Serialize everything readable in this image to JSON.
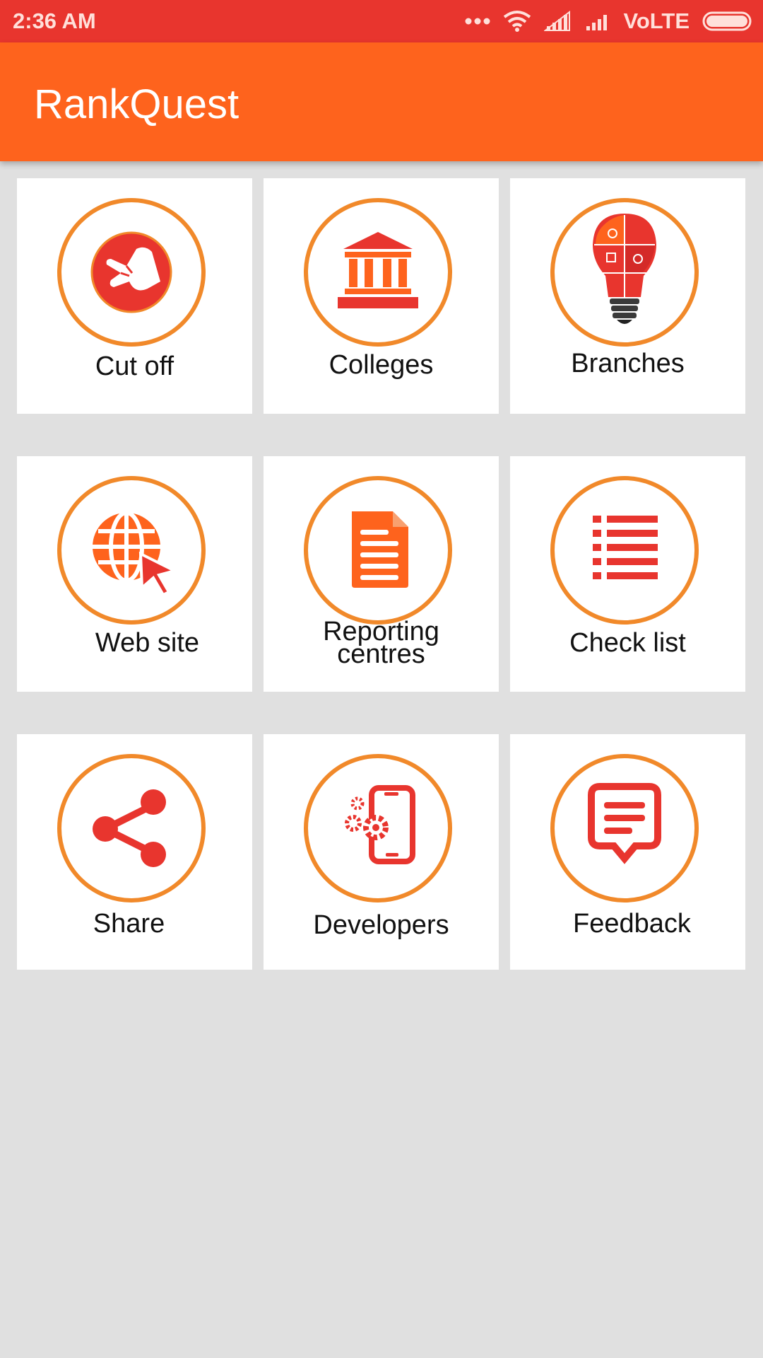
{
  "status_bar": {
    "time": "2:36 AM",
    "network_label": "VoLTE"
  },
  "app_bar": {
    "title": "RankQuest"
  },
  "tiles": [
    {
      "label": "Cut off",
      "icon": "victory-hand-icon"
    },
    {
      "label": "Colleges",
      "icon": "building-columns-icon"
    },
    {
      "label": "Branches",
      "icon": "puzzle-lightbulb-icon"
    },
    {
      "label": "Web site",
      "icon": "globe-cursor-icon"
    },
    {
      "label": "Reporting\ncentres",
      "icon": "document-icon"
    },
    {
      "label": "Check list",
      "icon": "list-icon"
    },
    {
      "label": "Share",
      "icon": "share-icon"
    },
    {
      "label": "Developers",
      "icon": "phone-gears-icon"
    },
    {
      "label": "Feedback",
      "icon": "chat-bubble-icon"
    }
  ],
  "colors": {
    "status_bar": "#e8352e",
    "app_bar": "#fe631d",
    "ring": "#f1892a",
    "icon_red": "#e8352e",
    "icon_orange": "#fe631d",
    "background": "#e0e0e0"
  }
}
